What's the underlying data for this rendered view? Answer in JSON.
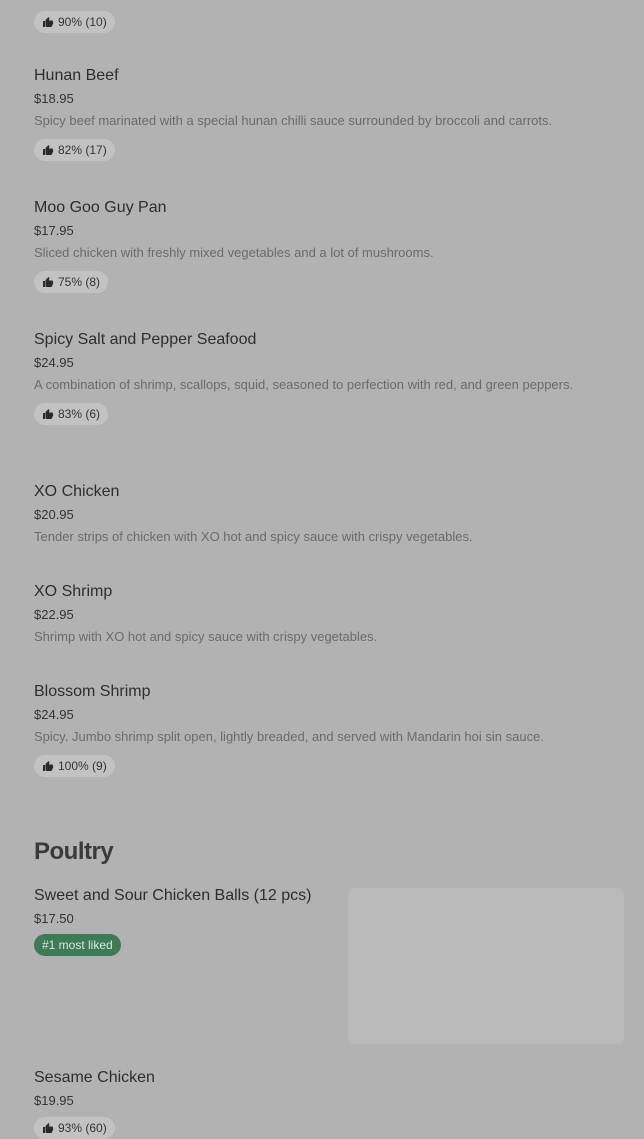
{
  "items": [
    {
      "rating": "90% (10)"
    },
    {
      "name": "Hunan Beef",
      "price": "$18.95",
      "description": "Spicy beef marinated with a special hunan chilli sauce surrounded by broccoli and carrots.",
      "rating": "82% (17)"
    },
    {
      "name": "Moo Goo Guy Pan",
      "price": "$17.95",
      "description": "Sliced chicken with freshly mixed vegetables and a lot of mushrooms.",
      "rating": "75% (8)"
    },
    {
      "name": "Spicy Salt and Pepper Seafood",
      "price": "$24.95",
      "description": "A combination of shrimp, scallops, squid, seasoned to perfection with red, and green peppers.",
      "rating": "83% (6)"
    },
    {
      "name": "XO Chicken",
      "price": "$20.95",
      "description": "Tender strips of chicken with XO hot and spicy sauce with crispy vegetables."
    },
    {
      "name": "XO Shrimp",
      "price": "$22.95",
      "description": "Shrimp with XO hot and spicy sauce with crispy vegetables."
    },
    {
      "name": "Blossom Shrimp",
      "price": "$24.95",
      "description": "Spicy. Jumbo shrimp split open, lightly breaded, and served with Mandarin hoi sin sauce.",
      "rating": "100% (9)"
    }
  ],
  "poultry": {
    "title": "Poultry",
    "items": [
      {
        "name": "Sweet and Sour Chicken Balls (12 pcs)",
        "price": "$17.50",
        "badge": "#1 most liked"
      },
      {
        "name": "Sesame Chicken",
        "price": "$19.95",
        "rating": "93% (60)"
      }
    ]
  },
  "icons": {
    "thumb": "thumbs-up-icon"
  }
}
